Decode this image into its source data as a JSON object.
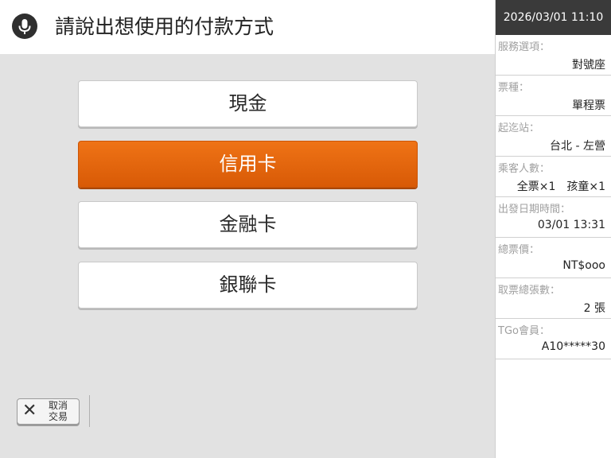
{
  "prompt": {
    "icon": "microphone-icon",
    "text": "請說出想使用的付款方式"
  },
  "payment_options": [
    {
      "label": "現金",
      "selected": false
    },
    {
      "label": "信用卡",
      "selected": true
    },
    {
      "label": "金融卡",
      "selected": false
    },
    {
      "label": "銀聯卡",
      "selected": false
    }
  ],
  "cancel": {
    "icon": "close-icon",
    "symbol": "✕",
    "line1": "取消",
    "line2": "交易"
  },
  "sidebar": {
    "datetime": "2026/03/01 11:10",
    "items": [
      {
        "label": "服務選項：",
        "value": "對號座"
      },
      {
        "label": "票種：",
        "value": "單程票"
      },
      {
        "label": "起迄站：",
        "value": "台北 - 左營"
      },
      {
        "label": "乘客人數：",
        "value": "全票×1　孩童×1"
      },
      {
        "label": "出發日期時間：",
        "value": "03/01 13:31"
      },
      {
        "label": "總票價：",
        "value": "NT$ooo"
      },
      {
        "label": "取票總張數：",
        "value": "2 張"
      },
      {
        "label": "TGo會員：",
        "value": "A10*****30"
      }
    ]
  },
  "colors": {
    "accent": "#e8680e",
    "header_dark": "#3a3a3a",
    "background": "#e2e2e2"
  }
}
